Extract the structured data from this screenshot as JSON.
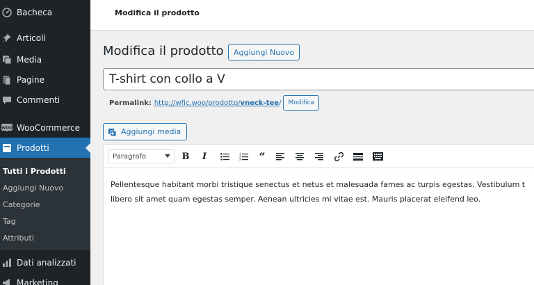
{
  "sidebar": {
    "items": [
      {
        "label": "Bacheca",
        "icon": "dashboard-icon"
      },
      {
        "label": "Articoli",
        "icon": "pin-icon"
      },
      {
        "label": "Media",
        "icon": "media-icon"
      },
      {
        "label": "Pagine",
        "icon": "page-icon"
      },
      {
        "label": "Commenti",
        "icon": "comment-icon"
      },
      {
        "label": "WooCommerce",
        "icon": "woocommerce-icon"
      },
      {
        "label": "Prodotti",
        "icon": "archive-icon"
      },
      {
        "label": "Dati analizzati",
        "icon": "chart-icon"
      },
      {
        "label": "Marketing",
        "icon": "megaphone-icon"
      }
    ],
    "submenu": [
      "Tutti i Prodotti",
      "Aggiungi Nuovo",
      "Categorie",
      "Tag",
      "Attributi"
    ]
  },
  "topbar": {
    "title": "Modifica il prodotto"
  },
  "heading": {
    "title": "Modifica il prodotto",
    "add_new_label": "Aggiungi Nuovo"
  },
  "title_input": {
    "value": "T-shirt con collo a V"
  },
  "permalink": {
    "label": "Permalink:",
    "url_base": "http://wfic.woo/prodotto/",
    "slug": "vneck-tee",
    "sep": "/",
    "edit_label": "Modifica"
  },
  "media": {
    "add_media_label": "Aggiungi media"
  },
  "editor": {
    "format_selected": "Paragrafo",
    "toolbar_icons": [
      "bold-icon",
      "italic-icon",
      "bullet-list-icon",
      "numbered-list-icon",
      "blockquote-icon",
      "align-left-icon",
      "align-center-icon",
      "align-right-icon",
      "link-icon",
      "read-more-icon",
      "toolbar-toggle-icon"
    ],
    "content_line1": "Pellentesque habitant morbi tristique senectus et netus et malesuada fames ac turpis egestas. Vestibulum t",
    "content_line2": "libero sit amet quam egestas semper. Aenean ultricies mi vitae est. Mauris placerat eleifend leo."
  },
  "colors": {
    "accent": "#2271b1",
    "sidebar_bg": "#1d2327",
    "submenu_bg": "#2c3338"
  }
}
